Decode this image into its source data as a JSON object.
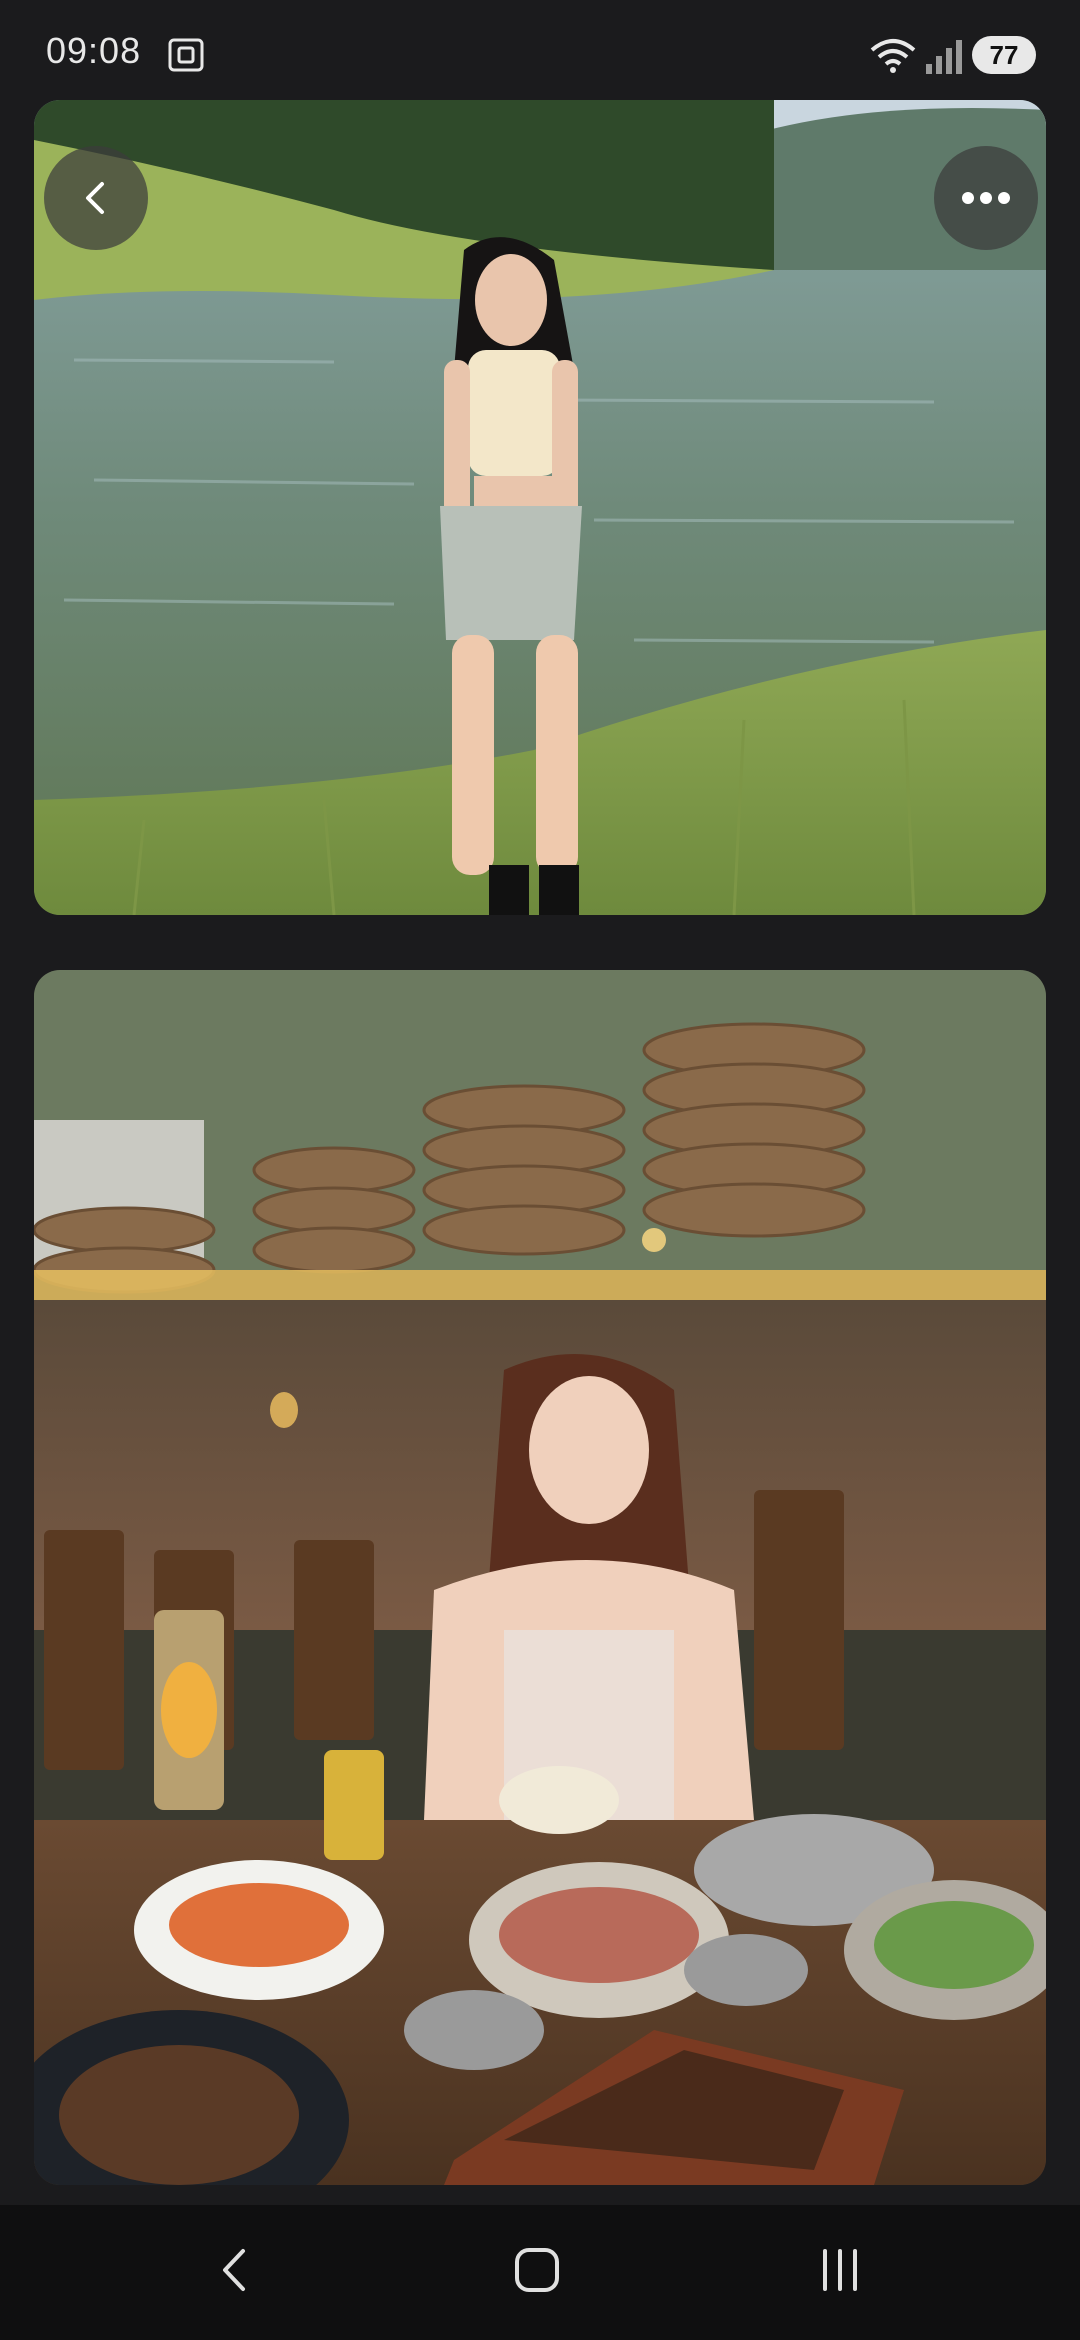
{
  "status_bar": {
    "time": "09:08",
    "battery": "77"
  },
  "icons": {
    "back": "chevron-left-icon",
    "more": "more-horizontal-icon",
    "nav_back": "nav-back-icon",
    "nav_home": "nav-home-icon",
    "nav_recents": "nav-recents-icon"
  },
  "colors": {
    "background": "#1b1b1d",
    "nav_bar": "#0f0f10",
    "overlay_button": "#3c3c3c"
  }
}
